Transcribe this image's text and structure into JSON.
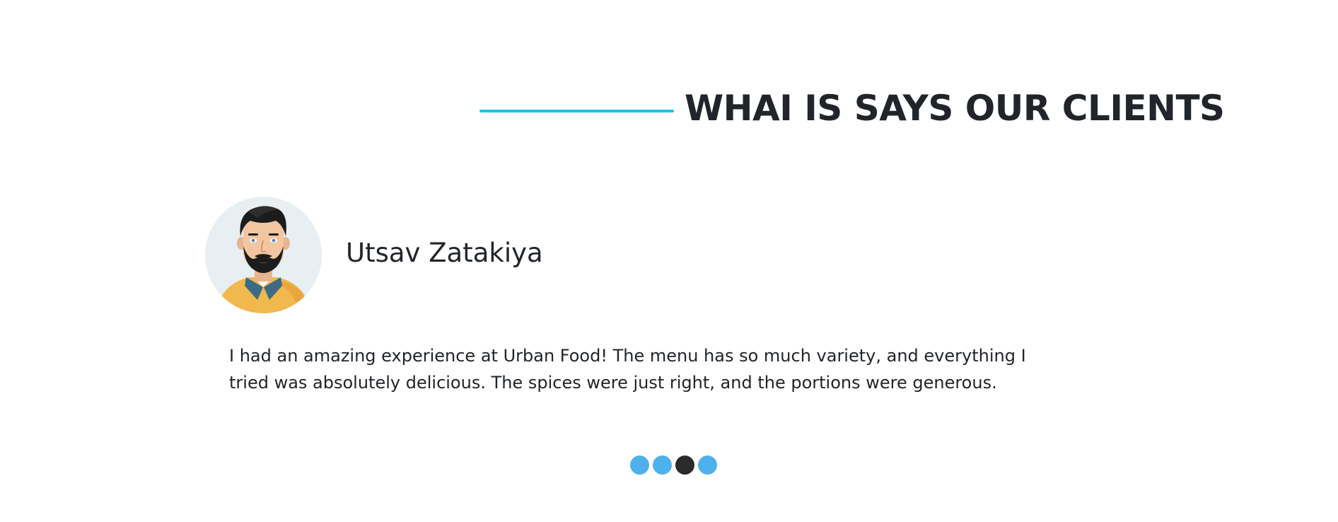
{
  "heading": {
    "title": "WHAI IS SAYS OUR CLIENTS",
    "accent_color": "#19c3e6"
  },
  "client": {
    "name": "Utsav Zatakiya",
    "avatar_icon": "bearded-man-avatar-icon",
    "testimonial": "I had an amazing experience at Urban Food! The menu has so much variety, and everything I tried was absolutely delicious. The spices were just right, and the portions were generous."
  },
  "carousel": {
    "slide_count": 4,
    "active_index": 2,
    "dot_color": "#4eb1ec",
    "active_dot_color": "#2a2a2a"
  }
}
